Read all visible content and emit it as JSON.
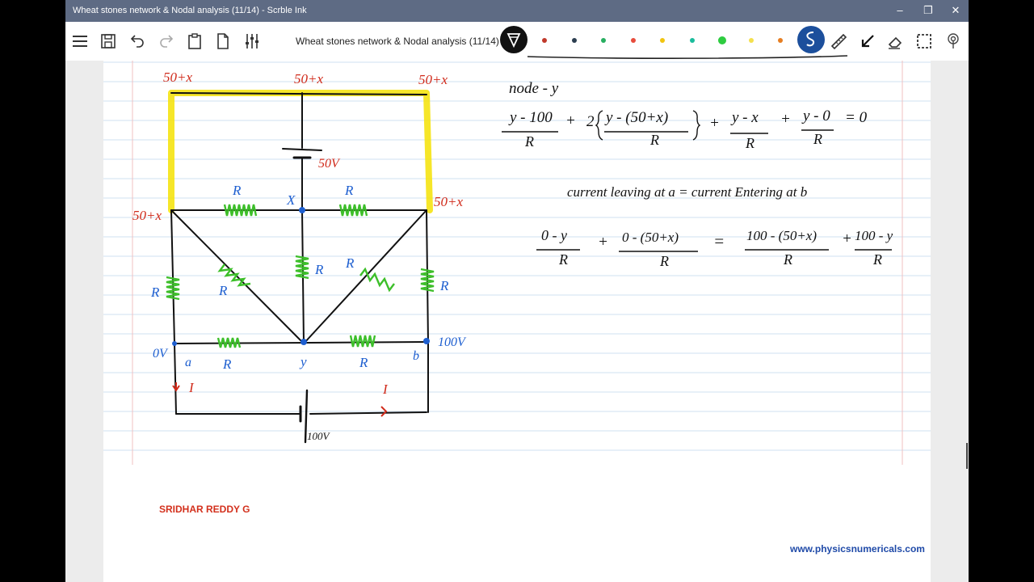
{
  "window": {
    "title": "Wheat stones  network & Nodal analysis (11/14) - Scrble Ink"
  },
  "toolbar": {
    "doc_title": "Wheat stones  network & Nodal analysis (11/14)"
  },
  "pens": [
    {
      "color": "#c0392b"
    },
    {
      "color": "#2c3e50"
    },
    {
      "color": "#27ae60"
    },
    {
      "color": "#e74c3c"
    },
    {
      "color": "#f1c40f"
    },
    {
      "color": "#1abc9c"
    },
    {
      "color": "#2ecc40"
    },
    {
      "color": "#f4e04d"
    },
    {
      "color": "#e67e22"
    }
  ],
  "circuit": {
    "node_top_left": "50+x",
    "node_top_mid": "50+x",
    "node_top_right": "50+x",
    "node_mid_left": "50+x",
    "node_mid_right": "50+x",
    "battery_top": "50V",
    "node_x": "X",
    "res_label": "R",
    "node_a_volt": "0V",
    "node_b_volt": "100V",
    "node_a": "a",
    "node_b": "b",
    "node_y": "y",
    "current": "I",
    "battery_bottom": "100V"
  },
  "equations": {
    "node_y_title": "node - y",
    "eq1_t1_num": "y - 100",
    "eq1_plus1": "+",
    "eq1_coef": "2",
    "eq1_t2_num": "y - (50+x)",
    "eq1_plus2": "+",
    "eq1_t3_num": "y - x",
    "eq1_plus3": "+",
    "eq1_t4_num": "y - 0",
    "eq1_rhs": "= 0",
    "den": "R",
    "sentence": "current leaving at a = current Entering at b",
    "eq2_t1_num": "0 - y",
    "eq2_plus1": "+",
    "eq2_t2_num": "0 - (50+x)",
    "eq2_eq": "=",
    "eq2_t3_num": "100 - (50+x)",
    "eq2_plus2": "+",
    "eq2_t4_num": "100 - y"
  },
  "footer": {
    "author": "SRIDHAR REDDY G",
    "url": "www.physicsnumericals.com"
  }
}
